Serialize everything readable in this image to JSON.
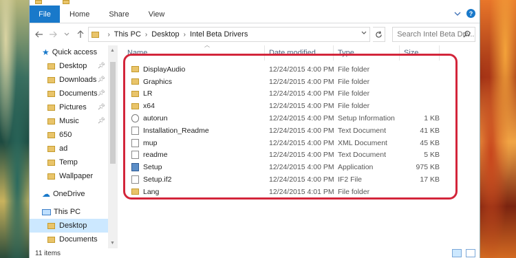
{
  "ribbon": {
    "tabs": [
      "File",
      "Home",
      "Share",
      "View"
    ]
  },
  "address": {
    "crumbs": [
      "This PC",
      "Desktop",
      "Intel Beta Drivers"
    ],
    "search_placeholder": "Search Intel Beta Driv..."
  },
  "navpane": {
    "quick_access": "Quick access",
    "quick_items": [
      {
        "label": "Desktop",
        "pinned": true
      },
      {
        "label": "Downloads",
        "pinned": true
      },
      {
        "label": "Documents",
        "pinned": true
      },
      {
        "label": "Pictures",
        "pinned": true
      },
      {
        "label": "Music",
        "pinned": true
      },
      {
        "label": "650",
        "pinned": false
      },
      {
        "label": "ad",
        "pinned": false
      },
      {
        "label": "Temp",
        "pinned": false
      },
      {
        "label": "Wallpaper",
        "pinned": false
      }
    ],
    "onedrive": "OneDrive",
    "this_pc": "This PC",
    "pc_items": [
      "Desktop",
      "Documents"
    ]
  },
  "columns": {
    "name": "Name",
    "date": "Date modified",
    "type": "Type",
    "size": "Size"
  },
  "files": [
    {
      "name": "DisplayAudio",
      "date": "12/24/2015 4:00 PM",
      "type": "File folder",
      "size": "",
      "icon": "folder"
    },
    {
      "name": "Graphics",
      "date": "12/24/2015 4:00 PM",
      "type": "File folder",
      "size": "",
      "icon": "folder"
    },
    {
      "name": "LR",
      "date": "12/24/2015 4:00 PM",
      "type": "File folder",
      "size": "",
      "icon": "folder"
    },
    {
      "name": "x64",
      "date": "12/24/2015 4:00 PM",
      "type": "File folder",
      "size": "",
      "icon": "folder"
    },
    {
      "name": "autorun",
      "date": "12/24/2015 4:00 PM",
      "type": "Setup Information",
      "size": "1 KB",
      "icon": "info"
    },
    {
      "name": "Installation_Readme",
      "date": "12/24/2015 4:00 PM",
      "type": "Text Document",
      "size": "41 KB",
      "icon": "doc"
    },
    {
      "name": "mup",
      "date": "12/24/2015 4:00 PM",
      "type": "XML Document",
      "size": "45 KB",
      "icon": "doc"
    },
    {
      "name": "readme",
      "date": "12/24/2015 4:00 PM",
      "type": "Text Document",
      "size": "5 KB",
      "icon": "doc"
    },
    {
      "name": "Setup",
      "date": "12/24/2015 4:00 PM",
      "type": "Application",
      "size": "975 KB",
      "icon": "app"
    },
    {
      "name": "Setup.if2",
      "date": "12/24/2015 4:00 PM",
      "type": "IF2 File",
      "size": "17 KB",
      "icon": "doc"
    },
    {
      "name": "Lang",
      "date": "12/24/2015 4:01 PM",
      "type": "File folder",
      "size": "",
      "icon": "folder"
    }
  ],
  "status": {
    "count": "11 items"
  },
  "colors": {
    "accent": "#1979ca",
    "highlight": "#d3253a",
    "selected": "#cce8ff"
  }
}
